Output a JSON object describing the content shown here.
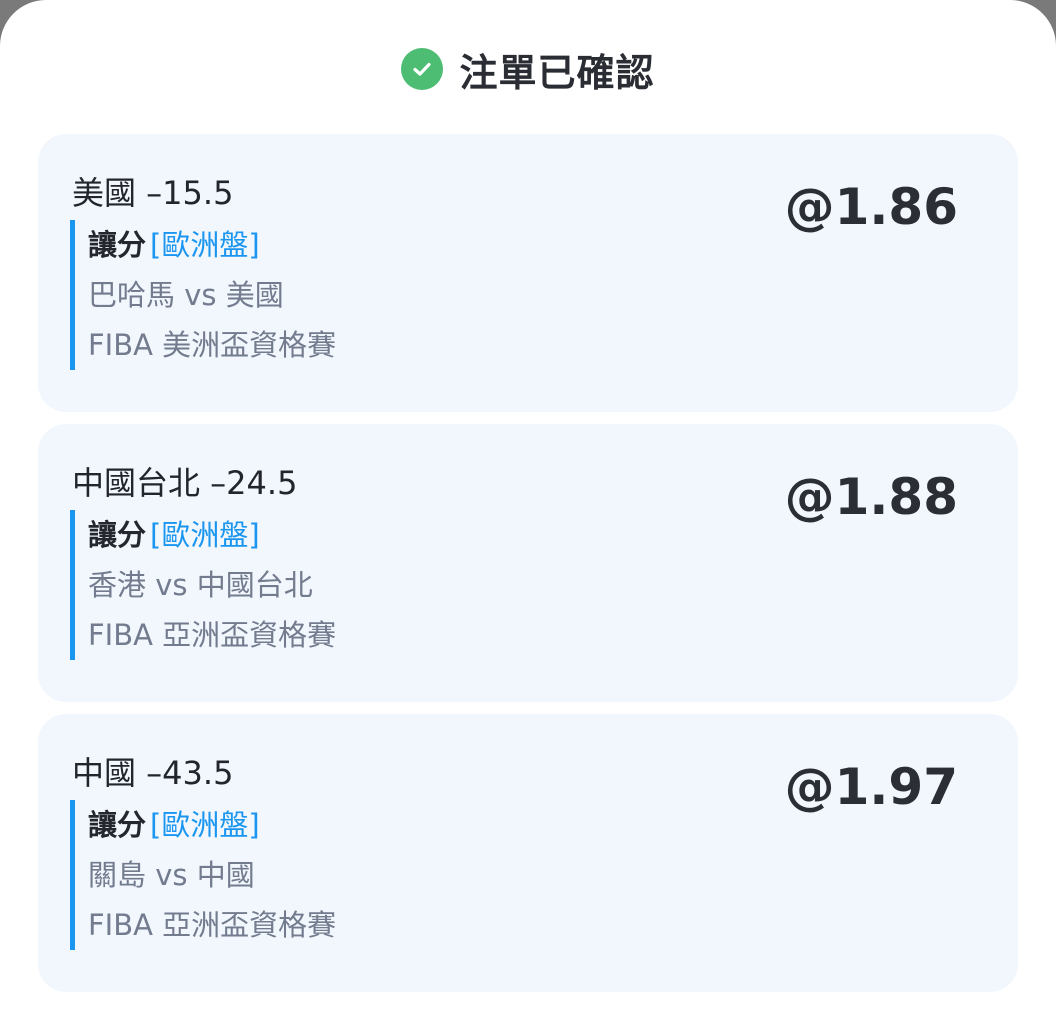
{
  "header": {
    "title": "注單已確認",
    "icon": "check-circle-icon",
    "icon_color": "#4cbd72"
  },
  "bets": [
    {
      "selection": "美國 –15.5",
      "odds": "@1.86",
      "market_type": "讓分",
      "market_tag": "[歐洲盤]",
      "match": "巴哈馬 vs 美國",
      "competition": "FIBA 美洲盃資格賽"
    },
    {
      "selection": "中國台北 –24.5",
      "odds": "@1.88",
      "market_type": "讓分",
      "market_tag": "[歐洲盤]",
      "match": "香港 vs 中國台北",
      "competition": "FIBA 亞洲盃資格賽"
    },
    {
      "selection": "中國 –43.5",
      "odds": "@1.97",
      "market_type": "讓分",
      "market_tag": "[歐洲盤]",
      "match": "關島 vs 中國",
      "competition": "FIBA 亞洲盃資格賽"
    }
  ],
  "colors": {
    "accent": "#1b96f0",
    "card_bg": "#f1f7fd",
    "success": "#4cbd72"
  }
}
